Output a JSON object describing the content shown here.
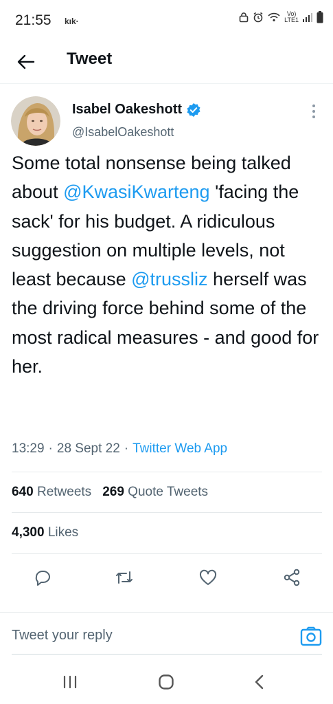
{
  "status_bar": {
    "time": "21:55",
    "app": "kık·",
    "network": "LTE1"
  },
  "header": {
    "back_icon": "arrow-left-icon",
    "title": "Tweet"
  },
  "tweet": {
    "author_name": "Isabel Oakeshott",
    "author_handle": "@IsabelOakeshott",
    "verified": true,
    "text_segments": [
      "Some total nonsense being talked about ",
      "@KwasiKwarteng",
      " 'facing the sack' for his budget. A ridiculous suggestion on multiple levels, not least because ",
      "@trussliz",
      " herself was the driving force behind some of the most radical measures - and good for her."
    ],
    "time": "13:29",
    "date": "28 Sept 22",
    "source": "Twitter Web App"
  },
  "stats": {
    "retweets_count": "640",
    "retweets_label": "Retweets",
    "quotes_count": "269",
    "quotes_label": "Quote Tweets",
    "likes_count": "4,300",
    "likes_label": "Likes"
  },
  "actions": {
    "reply_icon": "reply-icon",
    "retweet_icon": "retweet-icon",
    "like_icon": "heart-icon",
    "share_icon": "share-icon"
  },
  "reply": {
    "placeholder": "Tweet your reply",
    "camera_icon": "camera-icon"
  },
  "colors": {
    "accent": "#1d9bf0",
    "text": "#0f1419",
    "secondary": "#536471"
  }
}
